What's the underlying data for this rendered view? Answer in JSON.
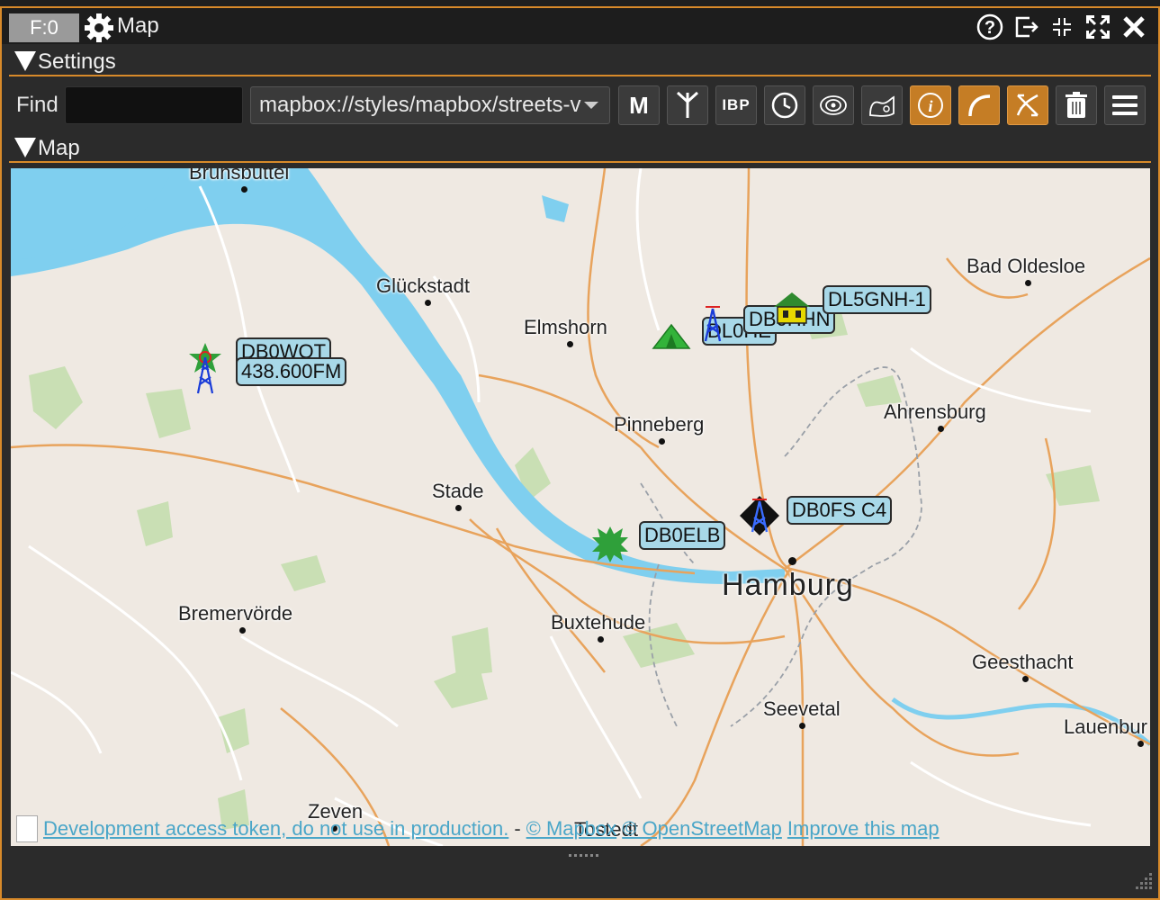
{
  "window": {
    "badge": "F:0",
    "title": "Map",
    "controls": [
      "help-icon",
      "exit-icon",
      "shrink-icon",
      "expand-icon",
      "close-icon"
    ]
  },
  "settings": {
    "header": "Settings",
    "find_label": "Find",
    "find_value": "",
    "style_value": "mapbox://styles/mapbox/streets-v",
    "tools": [
      {
        "name": "maidenhead-button",
        "label": "M",
        "active": false
      },
      {
        "name": "antenna-button",
        "label": "",
        "active": false
      },
      {
        "name": "ibp-button",
        "label": "IBP",
        "active": false
      },
      {
        "name": "clock-button",
        "label": "",
        "active": false
      },
      {
        "name": "beacon-button",
        "label": "",
        "active": false
      },
      {
        "name": "radiosonde-button",
        "label": "",
        "active": false
      },
      {
        "name": "info-button",
        "label": "",
        "active": true
      },
      {
        "name": "track-button",
        "label": "",
        "active": true
      },
      {
        "name": "nav-button",
        "label": "",
        "active": true
      },
      {
        "name": "delete-button",
        "label": "",
        "active": false
      },
      {
        "name": "menu-button",
        "label": "",
        "active": false
      }
    ]
  },
  "map_section": {
    "header": "Map"
  },
  "map": {
    "places": {
      "brunsbuttel": "Brunsbüttel",
      "gluckstadt": "Glückstadt",
      "elmshorn": "Elmshorn",
      "bad_oldesloe": "Bad Oldesloe",
      "pinneberg": "Pinneberg",
      "ahrensburg": "Ahrensburg",
      "stade": "Stade",
      "hamburg": "Hamburg",
      "bremervorde": "Bremervörde",
      "buxtehude": "Buxtehude",
      "geesthacht": "Geesthacht",
      "seevetal": "Seevetal",
      "lauenburg": "Lauenbur",
      "zeven": "Zeven",
      "tostedt": "Tostedt"
    },
    "callouts": {
      "db0wot": "DB0WOT",
      "freq": "438.600FM",
      "dl0": "DL0HE",
      "db0": "DB0HHN",
      "dl5gnh": "DL5GNH-1",
      "db0elb": "DB0ELB",
      "db0fs": "DB0FS C4"
    },
    "attribution": {
      "dev_token": "Development access token, do not use in production.",
      "separator": "-",
      "mapbox": "© Mapbox",
      "osm": "© OpenStreetMap",
      "improve": "Improve this map"
    }
  },
  "colors": {
    "accent": "#d88a2a",
    "water": "#7fcfef",
    "land": "#efe9e2",
    "callout": "#a8d8e8"
  }
}
